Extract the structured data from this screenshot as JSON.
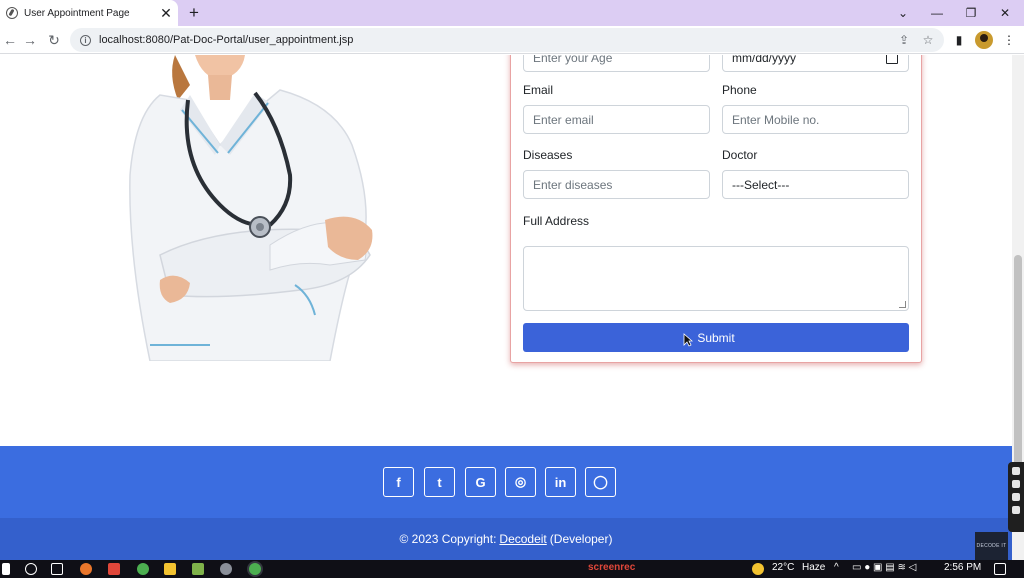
{
  "browser": {
    "tab_title": "User Appointment Page",
    "tab_close": "✕",
    "new_tab": "+",
    "url": "localhost:8080/Pat-Doc-Portal/user_appointment.jsp",
    "window_controls": [
      "⌄",
      "—",
      "❐",
      "✕"
    ]
  },
  "form": {
    "age_placeholder": "Enter your Age",
    "date_placeholder": "mm/dd/yyyy",
    "email_label": "Email",
    "email_placeholder": "Enter email",
    "phone_label": "Phone",
    "phone_placeholder": "Enter Mobile no.",
    "diseases_label": "Diseases",
    "diseases_placeholder": "Enter diseases",
    "doctor_label": "Doctor",
    "doctor_selected": "---Select---",
    "address_label": "Full Address",
    "submit_label": "Submit"
  },
  "footer": {
    "social_icons": [
      "f",
      "t",
      "G",
      "◎",
      "in",
      "◯"
    ],
    "copyright_prefix": "© 2023 Copyright:",
    "copyright_link": "Decodeit",
    "copyright_suffix": "(Developer)"
  },
  "corner_logo": "DECODE IT",
  "taskbar": {
    "recorder": "screenrec",
    "weather_temp": "22°C",
    "weather_text": "Haze",
    "time": "2:56 PM"
  },
  "colors": {
    "tab_strip": "#dccdf3",
    "primary_button": "#3b63d9",
    "footer_top": "#3b6de0",
    "footer_bottom": "#3460cc",
    "card_shadow": "#e8a3a3"
  }
}
